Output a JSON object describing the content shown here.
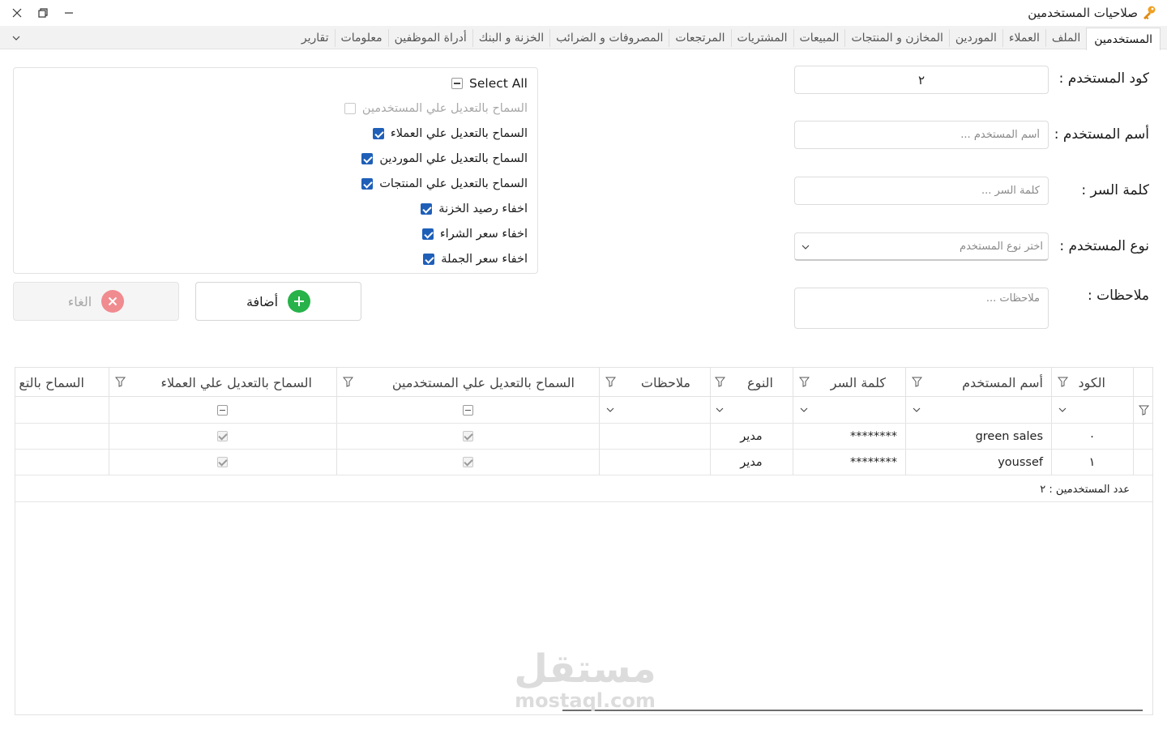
{
  "window": {
    "title": "صلاحيات المستخدمين",
    "icon": "key-icon",
    "controls": [
      "close",
      "restore",
      "minimize"
    ]
  },
  "tabs": [
    {
      "label": "المستخدمين",
      "active": true
    },
    {
      "label": "الملف"
    },
    {
      "label": "العملاء"
    },
    {
      "label": "الموردين"
    },
    {
      "label": "المخازن و المنتجات"
    },
    {
      "label": "المبيعات"
    },
    {
      "label": "المشتريات"
    },
    {
      "label": "المرتجعات"
    },
    {
      "label": "المصروفات و الضرائب"
    },
    {
      "label": "الخزنة و البنك"
    },
    {
      "label": "أدراة الموظفين"
    },
    {
      "label": "معلومات"
    },
    {
      "label": "تقارير"
    }
  ],
  "form": {
    "code_label": "كود المستخدم :",
    "code_value": "٢",
    "name_label": "أسم المستخدم :",
    "name_placeholder": "أسم المستخدم ...",
    "password_label": "كلمة السر :",
    "password_placeholder": "كلمة السر ...",
    "type_label": "نوع المستخدم :",
    "type_placeholder": "اختر نوع المستخدم",
    "notes_label": "ملاحظات :",
    "notes_placeholder": "ملاحظات ..."
  },
  "permissions": {
    "select_all": "Select All",
    "items": [
      {
        "label": "السماح بالتعديل علي المستخدمين",
        "checked": false,
        "disabled": true
      },
      {
        "label": "السماح بالتعديل علي العملاء",
        "checked": true
      },
      {
        "label": "السماح بالتعديل علي الموردين",
        "checked": true
      },
      {
        "label": "السماح بالتعديل علي المنتجات",
        "checked": true
      },
      {
        "label": "اخفاء رصيد الخزنة",
        "checked": true
      },
      {
        "label": "اخفاء سعر الشراء",
        "checked": true
      },
      {
        "label": "اخفاء سعر الجملة",
        "checked": true
      }
    ]
  },
  "buttons": {
    "add": "أضافة",
    "cancel": "الغاء"
  },
  "grid": {
    "columns": [
      "الكود",
      "أسم المستخدم",
      "كلمة السر",
      "النوع",
      "ملاحظات",
      "السماح بالتعديل علي المستخدمين",
      "السماح بالتعديل علي العملاء",
      "السماح بالتع"
    ],
    "rows": [
      {
        "code": "٠",
        "name": "green sales",
        "password": "********",
        "type": "مدير",
        "notes": "",
        "perm_users": true,
        "perm_customers": true
      },
      {
        "code": "١",
        "name": "youssef",
        "password": "********",
        "type": "مدير",
        "notes": "",
        "perm_users": true,
        "perm_customers": true
      }
    ],
    "footer": "عدد المستخدمين : ٢"
  },
  "watermark": {
    "arabic": "مستقل",
    "latin": "mostaql.com"
  },
  "colors": {
    "accent": "#1f5fb8",
    "add_icon": "#27b24a",
    "cancel_icon": "#f08b8f"
  }
}
